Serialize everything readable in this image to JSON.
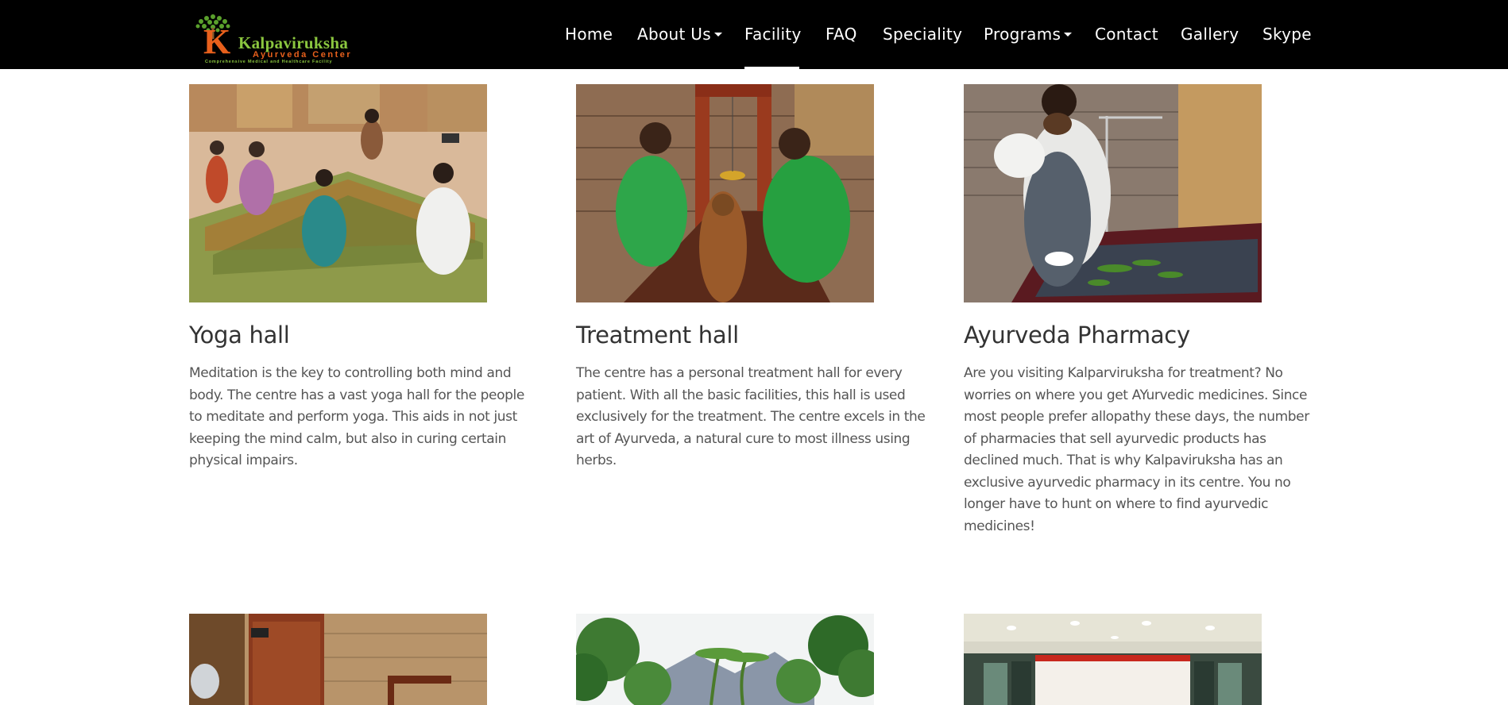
{
  "brand": {
    "name": "Kalpaviruksha",
    "initial": "K",
    "subtitle": "Ayurveda Center",
    "tagline": "Comprehensive Medical and Healthcare Facility"
  },
  "nav": {
    "items": [
      {
        "label": "Home",
        "has_dropdown": false
      },
      {
        "label": "About Us",
        "has_dropdown": true
      },
      {
        "label": "Facility",
        "has_dropdown": false,
        "active": true
      },
      {
        "label": "FAQ",
        "has_dropdown": false
      },
      {
        "label": "Speciality",
        "has_dropdown": false
      },
      {
        "label": "Programs",
        "has_dropdown": true
      },
      {
        "label": "Contact",
        "has_dropdown": false
      },
      {
        "label": "Gallery",
        "has_dropdown": false
      },
      {
        "label": "Skype",
        "has_dropdown": false
      }
    ]
  },
  "facilities": [
    {
      "title": "Yoga hall",
      "description": "Meditation is the key to controlling both mind and body. The centre has a vast yoga hall for the people to meditate and perform yoga. This aids in not just keeping the mind calm, but also in curing certain physical impairs."
    },
    {
      "title": "Treatment hall",
      "description": "The centre has a personal treatment hall for every patient. With all the basic facilities, this hall is used exclusively for the treatment. The centre excels in the art of Ayurveda, a natural cure to most illness using herbs."
    },
    {
      "title": "Ayurveda Pharmacy",
      "description": "Are you visiting Kalparviruksha for treatment? No worries on where you get AYurvedic medicines. Since most people prefer allopathy these days, the number of pharmacies that sell ayurvedic products has declined much. That is why Kalpaviruksha has an exclusive ayurvedic pharmacy in its centre. You no longer have to hunt on where to find ayurvedic medicines!"
    }
  ],
  "colors": {
    "header_bg": "#000000",
    "nav_text": "#ffffff",
    "title_text": "#333333",
    "body_text": "#555555",
    "logo_green": "#8bc63f",
    "logo_orange": "#e8601c"
  }
}
